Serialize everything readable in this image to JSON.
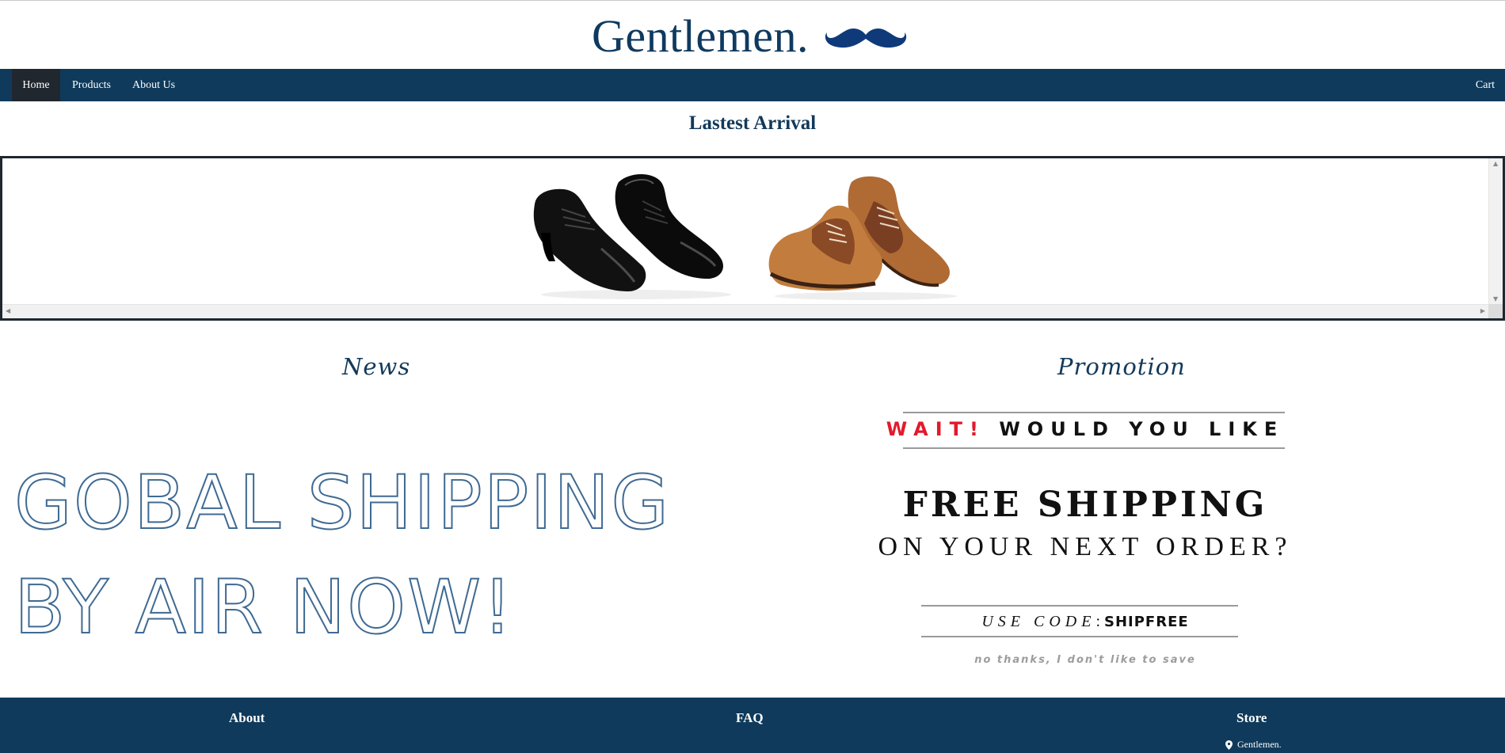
{
  "brand": {
    "title": "Gentlemen.",
    "logo_icon": "mustache-icon",
    "color": "#0f3a5f"
  },
  "nav": {
    "items": [
      {
        "label": "Home",
        "active": true
      },
      {
        "label": "Products",
        "active": false
      },
      {
        "label": "About Us",
        "active": false
      }
    ],
    "cart_label": "Cart",
    "background": "#0f3a5b",
    "active_background": "#21272e"
  },
  "latest": {
    "title": "Lastest Arrival",
    "images": [
      "black-oxford-shoes",
      "brown-saddle-shoes"
    ]
  },
  "news": {
    "title": "News",
    "banner_lines": [
      "GOBAL SHIPPING",
      "BY AIR NOW!"
    ]
  },
  "promotion": {
    "title": "Promotion",
    "wait": "WAIT!",
    "would_you_like": "WOULD YOU LIKE",
    "headline": "FREE SHIPPING",
    "subline": "ON YOUR NEXT ORDER?",
    "code_label": "USE CODE",
    "code": "SHIPFREE",
    "decline": "no thanks, I don't like to save",
    "accent": "#e21a2c"
  },
  "footer": {
    "about": "About",
    "faq": "FAQ",
    "store": "Store",
    "store_location": "Gentlemen.",
    "location_icon": "map-pin-icon",
    "background": "#0f3a5b"
  }
}
